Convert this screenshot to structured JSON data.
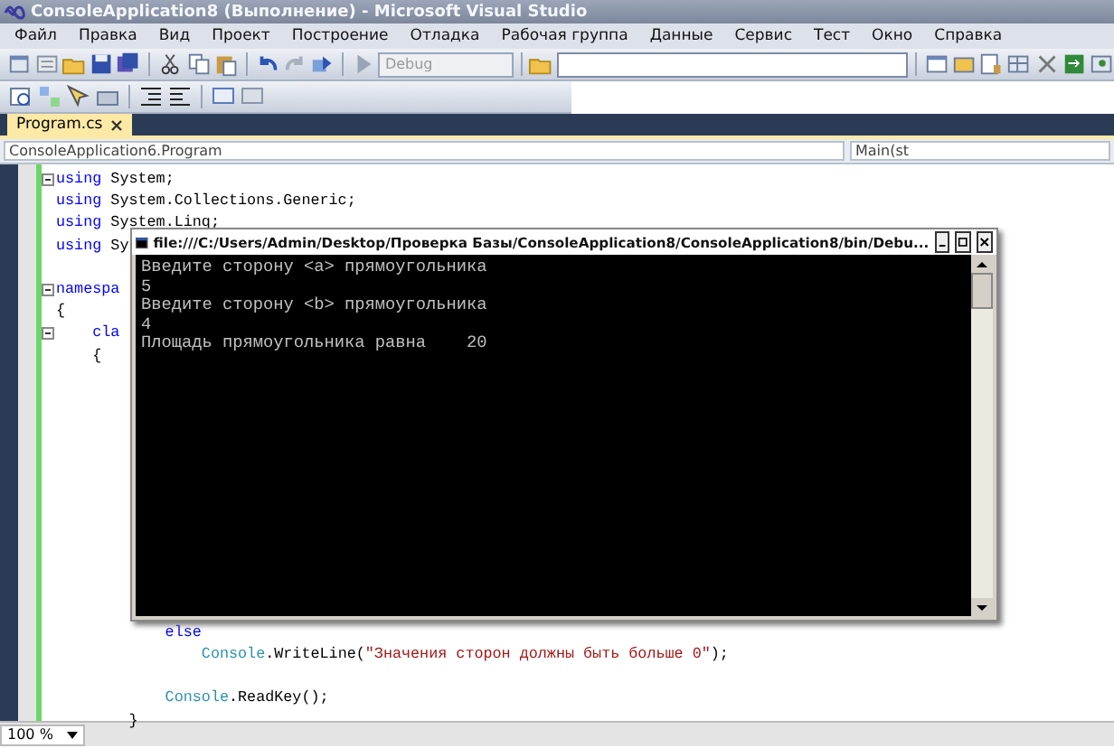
{
  "window": {
    "title": "ConsoleApplication8 (Выполнение) - Microsoft Visual Studio"
  },
  "menu": [
    "Файл",
    "Правка",
    "Вид",
    "Проект",
    "Построение",
    "Отладка",
    "Рабочая группа",
    "Данные",
    "Сервис",
    "Тест",
    "Окно",
    "Справка"
  ],
  "toolbar": {
    "configuration": "Debug",
    "configuration_disabled": true
  },
  "tabs": [
    {
      "label": "Program.cs",
      "selected": true
    }
  ],
  "nav_bar": {
    "type_selector": "ConsoleApplication6.Program",
    "member_selector": "Main(st"
  },
  "code": {
    "top_lines": [
      {
        "collapsible": true,
        "space_before": false,
        "tokens": [
          {
            "kind": "keyword",
            "text": "using"
          },
          {
            "kind": "plain",
            "text": " System;"
          }
        ]
      },
      {
        "collapsible": false,
        "space_before": false,
        "tokens": [
          {
            "kind": "keyword",
            "text": "using"
          },
          {
            "kind": "plain",
            "text": " System.Collections.Generic;"
          }
        ]
      },
      {
        "collapsible": false,
        "space_before": false,
        "tokens": [
          {
            "kind": "keyword",
            "text": "using"
          },
          {
            "kind": "plain",
            "text": " System.Linq;"
          }
        ]
      },
      {
        "collapsible": false,
        "space_before": false,
        "tokens": [
          {
            "kind": "keyword",
            "text": "using"
          },
          {
            "kind": "plain",
            "text": " Sy"
          }
        ]
      },
      {
        "collapsible": true,
        "space_before": true,
        "tokens": [
          {
            "kind": "keyword",
            "text": "namespa"
          }
        ]
      },
      {
        "collapsible": false,
        "space_before": false,
        "tokens": [
          {
            "kind": "plain",
            "text": "{"
          }
        ]
      },
      {
        "collapsible": true,
        "space_before": false,
        "tokens": [
          {
            "kind": "keyword",
            "text": "    cla"
          }
        ]
      },
      {
        "collapsible": false,
        "space_before": false,
        "tokens": [
          {
            "kind": "plain",
            "text": "    {"
          }
        ]
      }
    ],
    "bottom_lines": [
      {
        "space_before": false,
        "tokens": [
          {
            "kind": "keyword",
            "text": "            else"
          }
        ]
      },
      {
        "space_before": false,
        "tokens": [
          {
            "kind": "type",
            "text": "                Console"
          },
          {
            "kind": "plain",
            "text": ".WriteLine("
          },
          {
            "kind": "string",
            "text": "\"Значения сторон должны быть больше 0\""
          },
          {
            "kind": "plain",
            "text": ");"
          }
        ]
      },
      {
        "space_before": true,
        "tokens": [
          {
            "kind": "type",
            "text": "            Console"
          },
          {
            "kind": "plain",
            "text": ".ReadKey();"
          }
        ]
      },
      {
        "space_before": false,
        "tokens": [
          {
            "kind": "plain",
            "text": "        }"
          }
        ]
      }
    ]
  },
  "console": {
    "title": "file:///C:/Users/Admin/Desktop/Проверка Базы/ConsoleApplication8/ConsoleApplication8/bin/Debu...",
    "lines": [
      "Введите сторону <a> прямоугольника",
      "5",
      "Введите сторону <b> прямоугольника",
      "4",
      "Площадь прямоугольника равна    20"
    ]
  },
  "status_bar": {
    "zoom": "100 %"
  }
}
